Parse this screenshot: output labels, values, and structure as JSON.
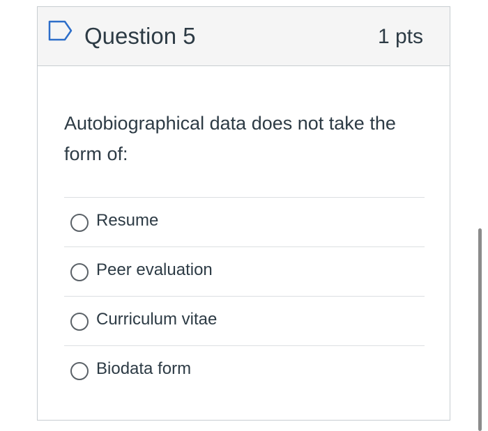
{
  "question": {
    "title": "Question 5",
    "points": "1 pts",
    "flag_icon": "flag-outline-icon",
    "text": "Autobiographical data does not take the form of:"
  },
  "answers": [
    {
      "label": "Resume",
      "selected": false
    },
    {
      "label": "Peer evaluation",
      "selected": false
    },
    {
      "label": "Curriculum vitae",
      "selected": false
    },
    {
      "label": "Biodata form",
      "selected": false
    }
  ],
  "colors": {
    "accent": "#2d6ec9",
    "text": "#2d3b45",
    "header_bg": "#f5f5f5",
    "border": "#c7cdd1"
  }
}
